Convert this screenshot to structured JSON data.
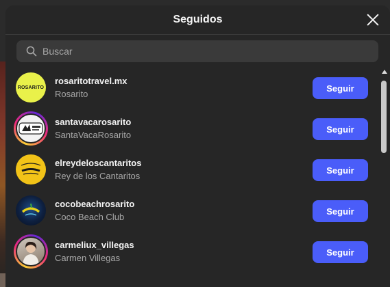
{
  "modal": {
    "title": "Seguidos",
    "close_icon": "close-icon"
  },
  "search": {
    "placeholder": "Buscar",
    "icon": "search-icon"
  },
  "accounts": [
    {
      "username": "rosaritotravel.mx",
      "fullname": "Rosarito",
      "avatar_text": "ROSARITO",
      "button": "Seguir",
      "story_ring": false
    },
    {
      "username": "santavacarosarito",
      "fullname": "SantaVacaRosarito",
      "avatar_text": "",
      "button": "Seguir",
      "story_ring": true
    },
    {
      "username": "elreydeloscantaritos",
      "fullname": "Rey de los Cantaritos",
      "avatar_text": "",
      "button": "Seguir",
      "story_ring": false
    },
    {
      "username": "cocobeachrosarito",
      "fullname": "Coco Beach Club",
      "avatar_text": "",
      "button": "Seguir",
      "story_ring": false
    },
    {
      "username": "carmeliux_villegas",
      "fullname": "Carmen Villegas",
      "avatar_text": "",
      "button": "Seguir",
      "story_ring": true
    }
  ],
  "colors": {
    "follow_button": "#4a5df9",
    "modal_bg": "#262626",
    "search_bg": "#3a3a3a"
  }
}
